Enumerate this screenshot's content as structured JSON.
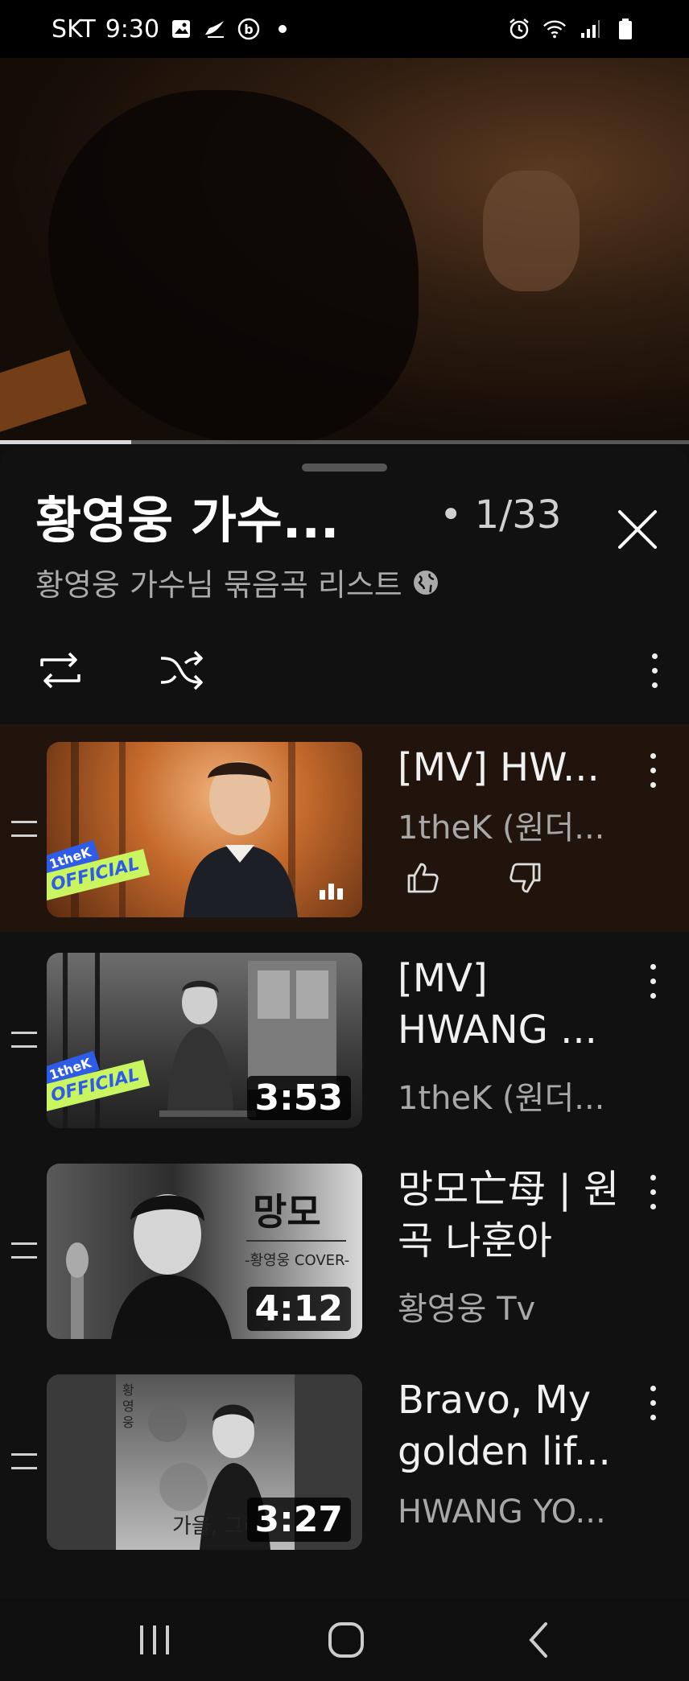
{
  "status_bar": {
    "carrier": "SKT",
    "time": "9:30"
  },
  "video_player": {
    "progress": 0.19
  },
  "playlist": {
    "title": "황영웅 가수...",
    "position": "• 1/33",
    "subtitle": "황영웅 가수님 묶음곡 리스트"
  },
  "items": [
    {
      "title": "[MV] HW...",
      "channel": "1theK (원더...",
      "badge_top": "1theK",
      "badge_bottom": "OFFICIAL"
    },
    {
      "title": "[MV] HWANG ...",
      "channel": "1theK (원더...",
      "duration": "3:53",
      "badge_top": "1theK",
      "badge_bottom": "OFFICIAL"
    },
    {
      "title": "망모亡母 | 원곡 나훈아",
      "channel": "황영웅 Tv",
      "duration": "4:12",
      "overlay_title": "망모",
      "overlay_sub": "-황영웅 COVER-"
    },
    {
      "title": "Bravo, My golden lif...",
      "channel": "HWANG YO...",
      "duration": "3:27",
      "overlay_text": "가을, 그리",
      "overlay_vertical": "황영웅"
    }
  ],
  "icons": {
    "close": "close-icon",
    "loop": "loop-icon",
    "shuffle": "shuffle-icon",
    "more": "more-vert-icon",
    "like": "thumb-up-icon",
    "dislike": "thumb-down-icon",
    "drag": "drag-handle-icon",
    "globe": "globe-icon"
  },
  "colors": {
    "background": "#0f0f0f",
    "active_row": "#21140c",
    "badge_blue": "#2f5ce6",
    "badge_green": "#c8f560"
  }
}
